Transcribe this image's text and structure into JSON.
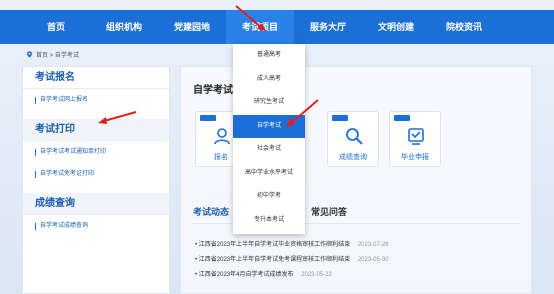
{
  "nav": {
    "items": [
      "首页",
      "组织机构",
      "党建园地",
      "考试项目",
      "服务大厅",
      "文明创建",
      "院校资讯"
    ],
    "active_index": 3
  },
  "breadcrumb": {
    "text": "首页 > 自学考试"
  },
  "sidebar": {
    "section1": {
      "title": "考试报名",
      "items": [
        "自学考试网上报名"
      ]
    },
    "section2": {
      "title": "考试打印",
      "items": [
        "自学考试考试通知单打印",
        "自学考试免考证打印"
      ]
    },
    "section3": {
      "title": "成绩查询",
      "items": [
        "自学考试成绩查询"
      ]
    }
  },
  "main": {
    "title": "自学考试",
    "cards": [
      {
        "label": "报名",
        "icon": "user-icon"
      },
      {
        "label": "成绩查询",
        "icon": "search-icon"
      },
      {
        "label": "毕业申报",
        "icon": "certificate-icon"
      }
    ],
    "tabs": [
      "考试动态",
      "常见问答"
    ],
    "news": [
      {
        "text": "江西省2023年上半年自学考试毕业资格审核工作顺利结束",
        "date": "2023-07-28"
      },
      {
        "text": "江西省2023年上半年自学考试免考课程审核工作顺利结束",
        "date": "2023-05-30"
      },
      {
        "text": "江西省2023年4月自学考试成绩发布",
        "date": "2023-05-22"
      }
    ]
  },
  "dropdown": {
    "items": [
      "普通高考",
      "成人高考",
      "研究生考试",
      "自学考试",
      "社会考试",
      "高中学业水平考试",
      "初中学考",
      "专升本考试"
    ],
    "highlight_index": 3
  },
  "colors": {
    "nav_bg": "#1c6fd6",
    "accent": "#1c5fb0",
    "annotation": "#e0211b"
  }
}
